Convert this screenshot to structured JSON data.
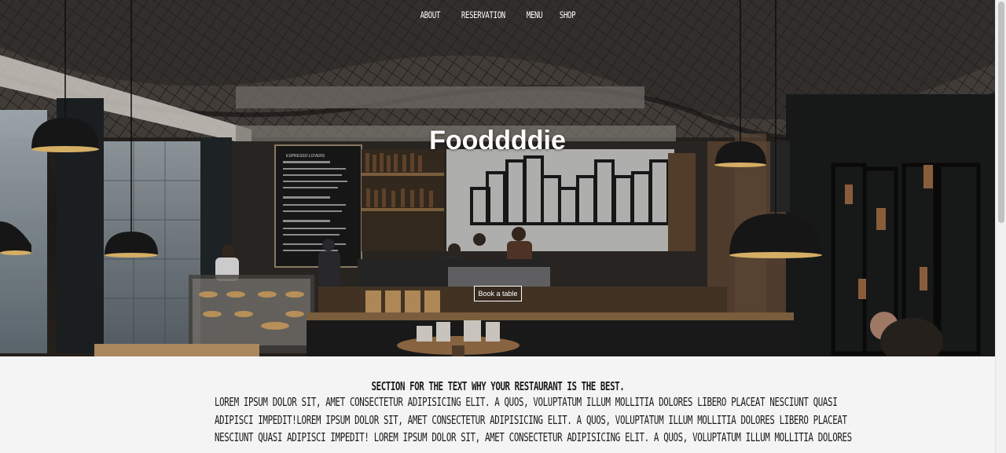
{
  "nav": {
    "items": [
      {
        "label": "ABOUT"
      },
      {
        "label": "RESERVATION"
      },
      {
        "label": "MENU"
      },
      {
        "label": "SHOP"
      }
    ]
  },
  "hero": {
    "title": "Fooddddie",
    "button_label": "Book a table",
    "menu_board_title": "ESPRESSO LOVERS"
  },
  "section": {
    "heading": "SECTION FOR THE TEXT WHY YOUR RESTAURANT IS THE BEST.",
    "body_lines": [
      "LOREM IPSUM DOLOR SIT, AMET CONSECTETUR ADIPISICING ELIT. A QUOS, VOLUPTATUM ILLUM MOLLITIA DOLORES LIBERO PLACEAT NESCIUNT QUASI",
      "ADIPISCI IMPEDIT!LOREM IPSUM DOLOR SIT, AMET CONSECTETUR ADIPISICING ELIT. A QUOS, VOLUPTATUM ILLUM MOLLITIA DOLORES LIBERO PLACEAT",
      "NESCIUNT QUASI ADIPISCI IMPEDIT! LOREM IPSUM DOLOR SIT, AMET CONSECTETUR ADIPISICING ELIT. A QUOS, VOLUPTATUM ILLUM MOLLITIA DOLORES"
    ]
  },
  "colors": {
    "nav_text": "#ffffff",
    "hero_title": "#ffffff",
    "content_bg": "#f4f4f4",
    "content_text": "#1a1a1a"
  }
}
